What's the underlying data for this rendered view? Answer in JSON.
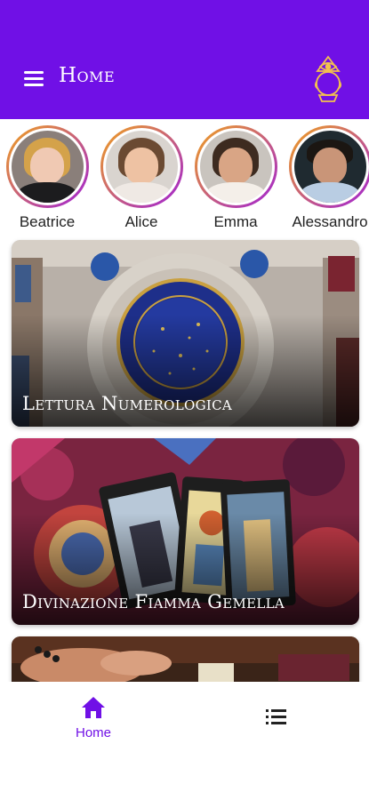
{
  "header": {
    "title": "Home",
    "background_color": "#7010e6",
    "menu_icon": "hamburger-menu-icon",
    "logo_icon": "eye-crystal-ball-logo-icon"
  },
  "stories": [
    {
      "name": "Beatrice"
    },
    {
      "name": "Alice"
    },
    {
      "name": "Emma"
    },
    {
      "name": "Alessandro"
    }
  ],
  "cards": [
    {
      "title": "Lettura Numerologica"
    },
    {
      "title": "Divinazione Fiamma Gemella"
    },
    {
      "title": ""
    }
  ],
  "bottom_nav": {
    "items": [
      {
        "label": "Home",
        "icon": "home-icon",
        "active": true
      },
      {
        "label": "",
        "icon": "list-icon",
        "active": false
      }
    ],
    "accent_color": "#7010e6"
  }
}
